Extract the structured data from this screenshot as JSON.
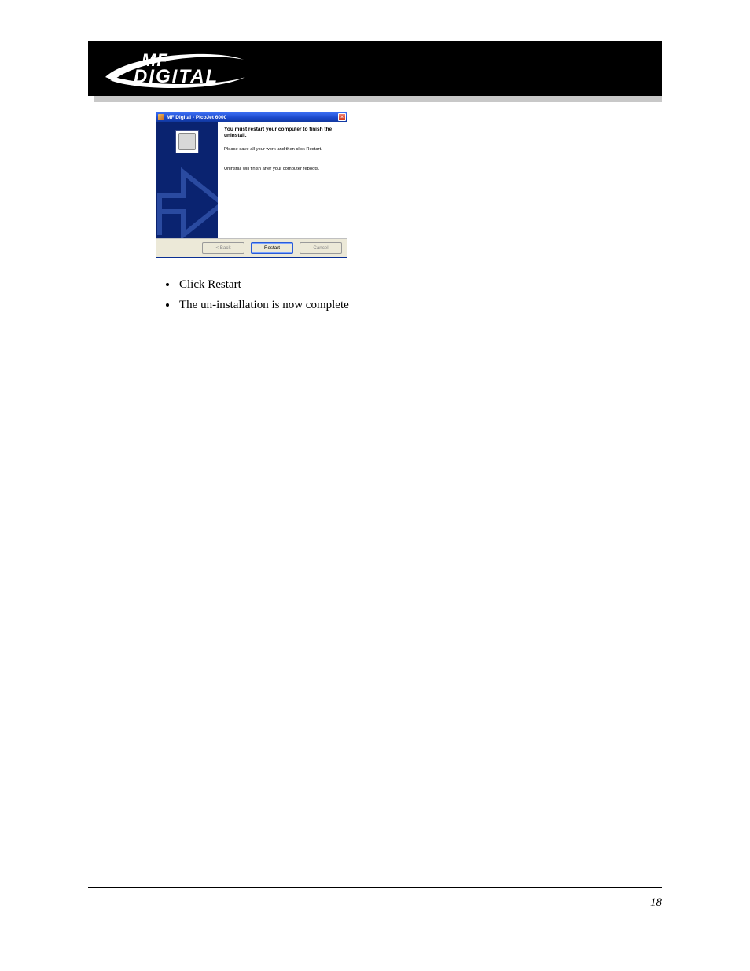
{
  "banner": {
    "logo_mf": "MF",
    "logo_digital": "DIGITAL"
  },
  "dialog": {
    "title": "MF Digital - PicoJet 6000",
    "headline": "You must restart your computer to finish the uninstall.",
    "line1": "Please save all your work and then click Restart.",
    "line2": "Uninstall will finish after your computer reboots.",
    "btn_back": "< Back",
    "btn_restart": "Restart",
    "btn_cancel": "Cancel",
    "close_glyph": "×"
  },
  "bullets": [
    "Click Restart",
    "The un-installation is now complete"
  ],
  "page_number": "18"
}
